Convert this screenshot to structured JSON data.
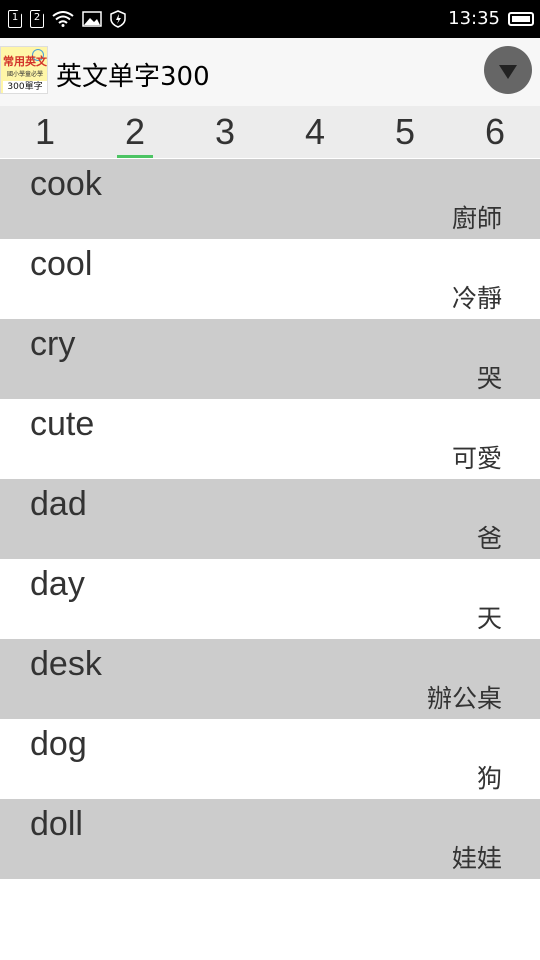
{
  "status_bar": {
    "sim1": "1",
    "sim2": "2",
    "time": "13:35",
    "icons": [
      "sim1-icon",
      "sim2-icon",
      "wifi-icon",
      "image-icon",
      "shield-icon",
      "battery-icon"
    ]
  },
  "app_bar": {
    "title": "英文单字300",
    "logo": {
      "top": "常用英文",
      "middle": "國小學童必學",
      "bottom": "300單字"
    },
    "menu_icon": "dropdown-arrow-icon"
  },
  "tabs": [
    {
      "label": "1",
      "active": false
    },
    {
      "label": "2",
      "active": true
    },
    {
      "label": "3",
      "active": false
    },
    {
      "label": "4",
      "active": false
    },
    {
      "label": "5",
      "active": false
    },
    {
      "label": "6",
      "active": false
    }
  ],
  "words": [
    {
      "en": "cook",
      "zh": "廚師"
    },
    {
      "en": "cool",
      "zh": "冷靜"
    },
    {
      "en": "cry",
      "zh": "哭"
    },
    {
      "en": "cute",
      "zh": "可愛"
    },
    {
      "en": "dad",
      "zh": "爸"
    },
    {
      "en": "day",
      "zh": "天"
    },
    {
      "en": "desk",
      "zh": "辦公桌"
    },
    {
      "en": "dog",
      "zh": "狗"
    },
    {
      "en": "doll",
      "zh": "娃娃"
    }
  ],
  "colors": {
    "accent": "#4cc463",
    "row_shaded": "#cccccc",
    "row_plain": "#ffffff",
    "tab_bar": "#ececec"
  }
}
